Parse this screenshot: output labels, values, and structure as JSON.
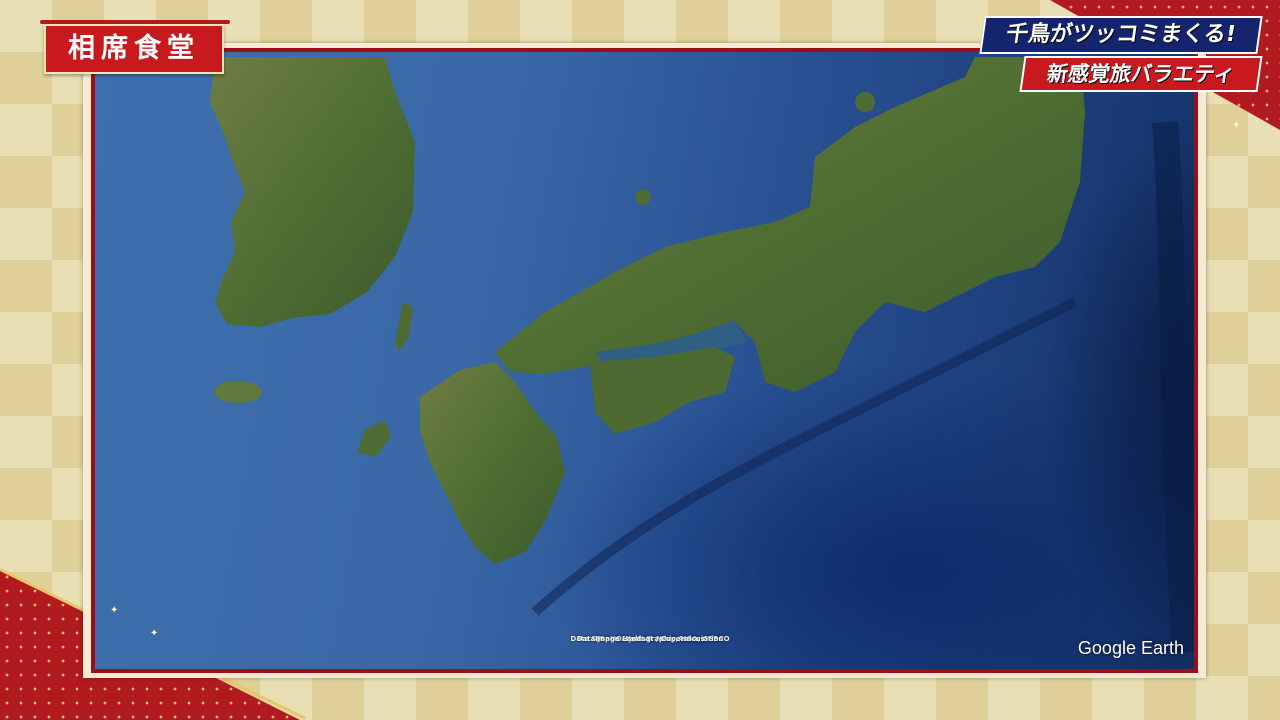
{
  "show": {
    "title": "相席食堂"
  },
  "captions": {
    "line1": "千鳥がツッコミまくる!",
    "line2": "新感覚旅バラエティ"
  },
  "map": {
    "attribution": [
      "Data SIO, NOAA, U.S. Navy, NGA, GEBCO",
      "Data Japan Hydrographic Association",
      "Image Landsat / Copernicus"
    ],
    "brand": "Google Earth",
    "colors": {
      "ocean_shallow": "#3f6fae",
      "ocean_deep": "#142f63",
      "land": "#4f6e33",
      "frame": "#9b1016"
    }
  },
  "theme": {
    "accent_red": "#c8191f",
    "accent_navy": "#14246e",
    "background_gold": "#e9dfb4"
  }
}
